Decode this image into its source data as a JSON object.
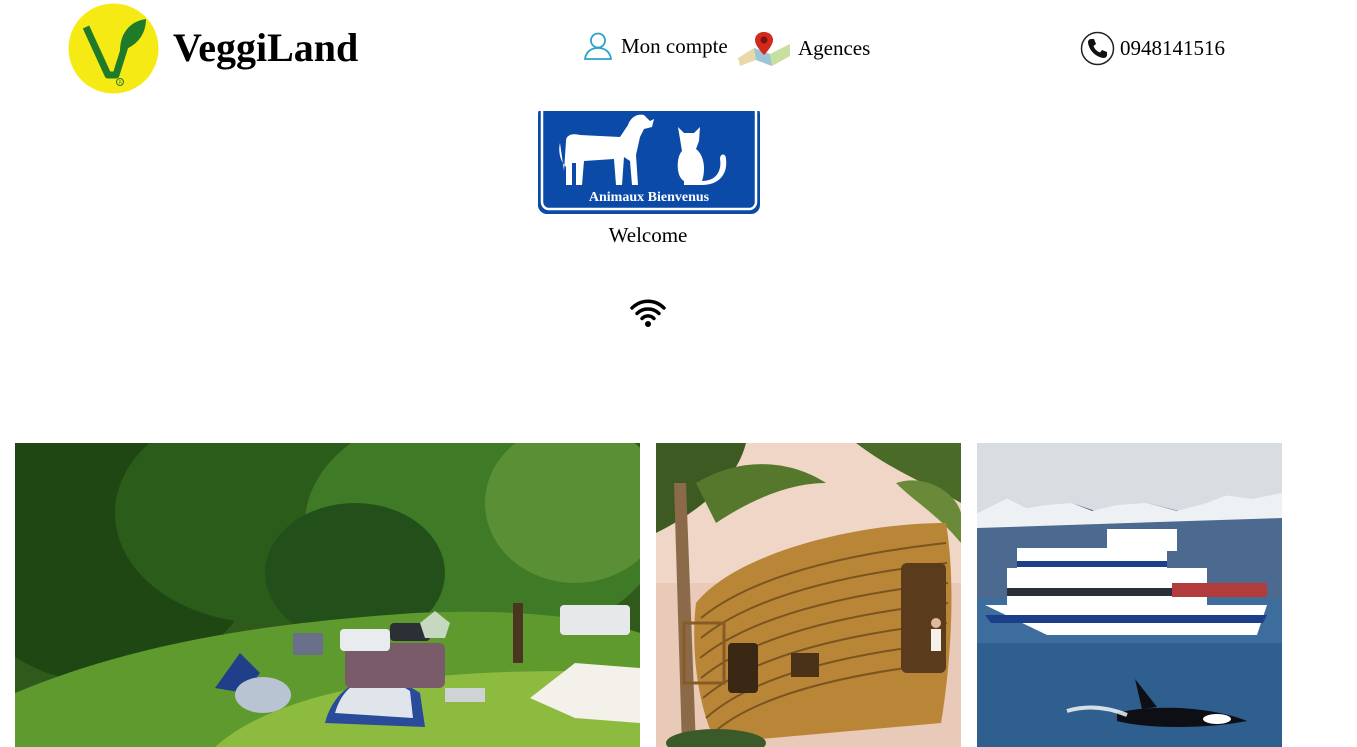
{
  "header": {
    "brand": "VeggiLand",
    "logo_icon": "vegan-v-leaf-logo",
    "account_label": "Mon compte",
    "account_icon": "user-icon",
    "agencies_label": "Agences",
    "agencies_icon": "map-pin-icon",
    "phone_number": "0948141516",
    "phone_icon": "phone-icon"
  },
  "main": {
    "pets_sign_text": "Animaux Bienvenus",
    "welcome_text": "Welcome",
    "wifi_icon": "wifi-icon"
  },
  "gallery": [
    {
      "name": "camping-photo",
      "subject": "campsite-with-tents"
    },
    {
      "name": "treehouse-photo",
      "subject": "bamboo-treehouse"
    },
    {
      "name": "whale-watching-photo",
      "subject": "boat-and-orca"
    }
  ],
  "colors": {
    "logo_yellow": "#f5ea14",
    "logo_green": "#1f7a2a",
    "sign_blue": "#0b4aa6",
    "account_icon": "#2aa3c9",
    "pin_red": "#d22a1d"
  }
}
